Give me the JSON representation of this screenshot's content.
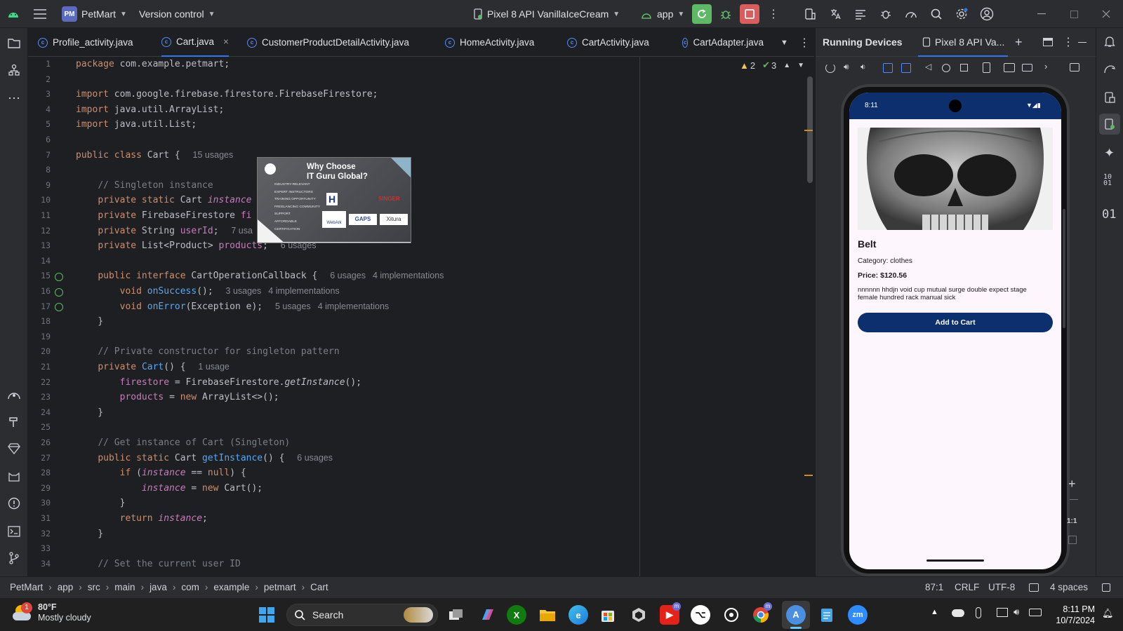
{
  "titlebar": {
    "project_badge": "PM",
    "project_name": "PetMart",
    "vcs": "Version control",
    "device": "Pixel 8 API VanillaIceCream",
    "run_config": "app"
  },
  "tabs": [
    {
      "label": "Profile_activity.java"
    },
    {
      "label": "Cart.java"
    },
    {
      "label": "CustomerProductDetailActivity.java"
    },
    {
      "label": "HomeActivity.java"
    },
    {
      "label": "CartActivity.java"
    },
    {
      "label": "CartAdapter.java"
    }
  ],
  "editor": {
    "warnings": "2",
    "checks": "3",
    "lines": [
      {
        "n": "1",
        "html": "<span class='k'>package</span> com.example.petmart;"
      },
      {
        "n": "2",
        "html": ""
      },
      {
        "n": "3",
        "html": "<span class='k'>import</span> com.google.firebase.firestore.FirebaseFirestore;"
      },
      {
        "n": "4",
        "html": "<span class='k'>import</span> java.util.ArrayList;"
      },
      {
        "n": "5",
        "html": "<span class='k'>import</span> java.util.List;"
      },
      {
        "n": "6",
        "html": ""
      },
      {
        "n": "7",
        "html": "<span class='k'>public class</span> Cart { <span class='hint'>15 usages</span>"
      },
      {
        "n": "8",
        "html": ""
      },
      {
        "n": "9",
        "html": "    <span class='c'>// Singleton instance</span>"
      },
      {
        "n": "10",
        "html": "    <span class='k'>private static</span> Cart <span class='f i'>instance</span>"
      },
      {
        "n": "11",
        "html": "    <span class='k'>private</span> FirebaseFirestore <span class='f'>fi</span>"
      },
      {
        "n": "12",
        "html": "    <span class='k'>private</span> String <span class='f'>userId</span>; <span class='hint'>7 usa</span>"
      },
      {
        "n": "13",
        "html": "    <span class='k'>private</span> List&lt;Product&gt; <span class='f'>products</span>; <span class='hint'>6 usages</span>"
      },
      {
        "n": "14",
        "html": ""
      },
      {
        "n": "15",
        "html": "    <span class='k'>public interface</span> CartOperationCallback { <span class='hint'>6 usages</span><span class='hint'>4 implementations</span>"
      },
      {
        "n": "16",
        "html": "        <span class='k'>void</span> <span class='m'>onSuccess</span>(); <span class='hint'>3 usages</span><span class='hint'>4 implementations</span>"
      },
      {
        "n": "17",
        "html": "        <span class='k'>void</span> <span class='m'>onError</span>(Exception e); <span class='hint'>5 usages</span><span class='hint'>4 implementations</span>"
      },
      {
        "n": "18",
        "html": "    }"
      },
      {
        "n": "19",
        "html": ""
      },
      {
        "n": "20",
        "html": "    <span class='c'>// Private constructor for singleton pattern</span>"
      },
      {
        "n": "21",
        "html": "    <span class='k'>private</span> <span class='m'>Cart</span>() { <span class='hint'>1 usage</span>"
      },
      {
        "n": "22",
        "html": "        <span class='f'>firestore</span> = FirebaseFirestore.<span class='i'>getInstance</span>();"
      },
      {
        "n": "23",
        "html": "        <span class='f'>products</span> = <span class='k'>new</span> ArrayList&lt;&gt;();"
      },
      {
        "n": "24",
        "html": "    }"
      },
      {
        "n": "25",
        "html": ""
      },
      {
        "n": "26",
        "html": "    <span class='c'>// Get instance of Cart (Singleton)</span>"
      },
      {
        "n": "27",
        "html": "    <span class='k'>public static</span> Cart <span class='m'>getInstance</span>() { <span class='hint'>6 usages</span>"
      },
      {
        "n": "28",
        "html": "        <span class='k'>if</span> (<span class='f i'>instance</span> == <span class='k'>null</span>) {"
      },
      {
        "n": "29",
        "html": "            <span class='f i'>instance</span> = <span class='k'>new</span> Cart();"
      },
      {
        "n": "30",
        "html": "        }"
      },
      {
        "n": "31",
        "html": "        <span class='k'>return</span> <span class='f i'>instance</span>;"
      },
      {
        "n": "32",
        "html": "    }"
      },
      {
        "n": "33",
        "html": ""
      },
      {
        "n": "34",
        "html": "    <span class='c'>// Set the current user ID</span>"
      }
    ]
  },
  "popup": {
    "title_line1": "Why Choose",
    "title_line2": "IT Guru Global?",
    "bullets": [
      "INDUSTRY-RELEVANT",
      "EXPERT INSTRUCTORS",
      "TRAINING OPPORTUNITY",
      "FREELANCING COMMUNITY",
      "SUPPORT",
      "AFFORDABLE",
      "CERTIFICATION"
    ],
    "logos": [
      "H",
      "SINGER",
      "WebArk",
      "GAPS",
      "Xitura"
    ]
  },
  "right_panel": {
    "title": "Running Devices",
    "device_tab": "Pixel 8 API Va...",
    "zoom_label": "1:1"
  },
  "phone": {
    "time": "8:11",
    "product_name": "Belt",
    "category": "Category: clothes",
    "price": "Price: $120.56",
    "description": "nnnnnn hhdjn void cup mutual surge double expect stage female hundred rack manual sick",
    "add_button": "Add to Cart"
  },
  "statusbar": {
    "breadcrumb": [
      "PetMart",
      "app",
      "src",
      "main",
      "java",
      "com",
      "example",
      "petmart",
      "Cart"
    ],
    "position": "87:1",
    "line_sep": "CRLF",
    "encoding": "UTF-8",
    "indent": "4 spaces"
  },
  "taskbar": {
    "weather_temp": "80°F",
    "weather_desc": "Mostly cloudy",
    "weather_badge": "1",
    "search": "Search",
    "time": "8:11 PM",
    "date": "10/7/2024"
  },
  "colors": {
    "accent": "#3574f0",
    "run_green": "#5fb865",
    "stop_red": "#db5c5c",
    "phone_dark_blue": "#0d2f6e"
  }
}
